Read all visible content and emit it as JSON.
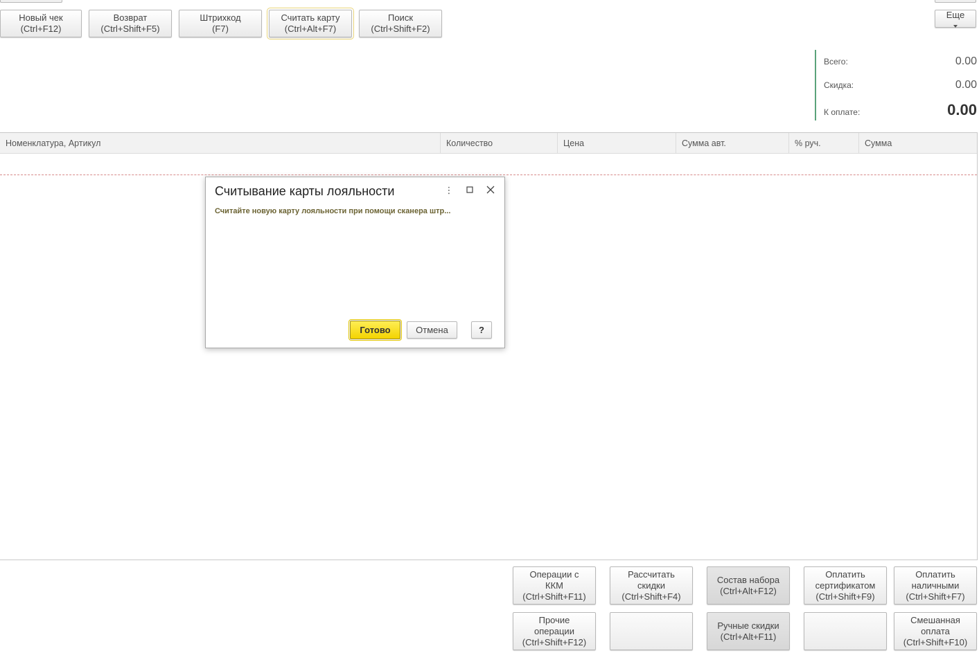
{
  "toolbar": {
    "buttons": [
      {
        "label": "Новый чек",
        "shortcut": "(Ctrl+F12)"
      },
      {
        "label": "Возврат",
        "shortcut": "(Ctrl+Shift+F5)"
      },
      {
        "label": "Штрихкод",
        "shortcut": "(F7)"
      },
      {
        "label": "Считать карту",
        "shortcut": "(Ctrl+Alt+F7)"
      },
      {
        "label": "Поиск",
        "shortcut": "(Ctrl+Shift+F2)"
      }
    ],
    "more_label": "Еще"
  },
  "totals": {
    "total_label": "Всего:",
    "total_value": "0.00",
    "discount_label": "Скидка:",
    "discount_value": "0.00",
    "topay_label": "К оплате:",
    "topay_value": "0.00"
  },
  "table": {
    "columns": [
      "Номенклатура, Артикул",
      "Количество",
      "Цена",
      "Сумма авт.",
      "% руч.",
      "Сумма"
    ]
  },
  "dialog": {
    "title": "Считывание карты лояльности",
    "message": "Считайте новую карту лояльности при помощи сканера штр...",
    "ok_label": "Готово",
    "cancel_label": "Отмена",
    "help_label": "?"
  },
  "bottom": {
    "buttons": [
      {
        "lines": [
          "Операции с",
          "ККМ",
          "(Ctrl+Shift+F11)"
        ]
      },
      {
        "lines": [
          "Рассчитать",
          "скидки",
          "(Ctrl+Shift+F4)"
        ]
      },
      {
        "lines": [
          "Состав набора",
          "(Ctrl+Alt+F12)"
        ]
      },
      {
        "lines": [
          "Оплатить",
          "сертификатом",
          "(Ctrl+Shift+F9)"
        ]
      },
      {
        "lines": [
          "Оплатить",
          "наличными",
          "(Ctrl+Shift+F7)"
        ]
      },
      {
        "lines": [
          "Прочие",
          "операции",
          "(Ctrl+Shift+F12)"
        ]
      },
      {
        "lines": []
      },
      {
        "lines": [
          "Ручные скидки",
          "(Ctrl+Alt+F11)"
        ]
      },
      {
        "lines": []
      },
      {
        "lines": [
          "Смешанная",
          "оплата",
          "(Ctrl+Shift+F10)"
        ]
      }
    ]
  }
}
